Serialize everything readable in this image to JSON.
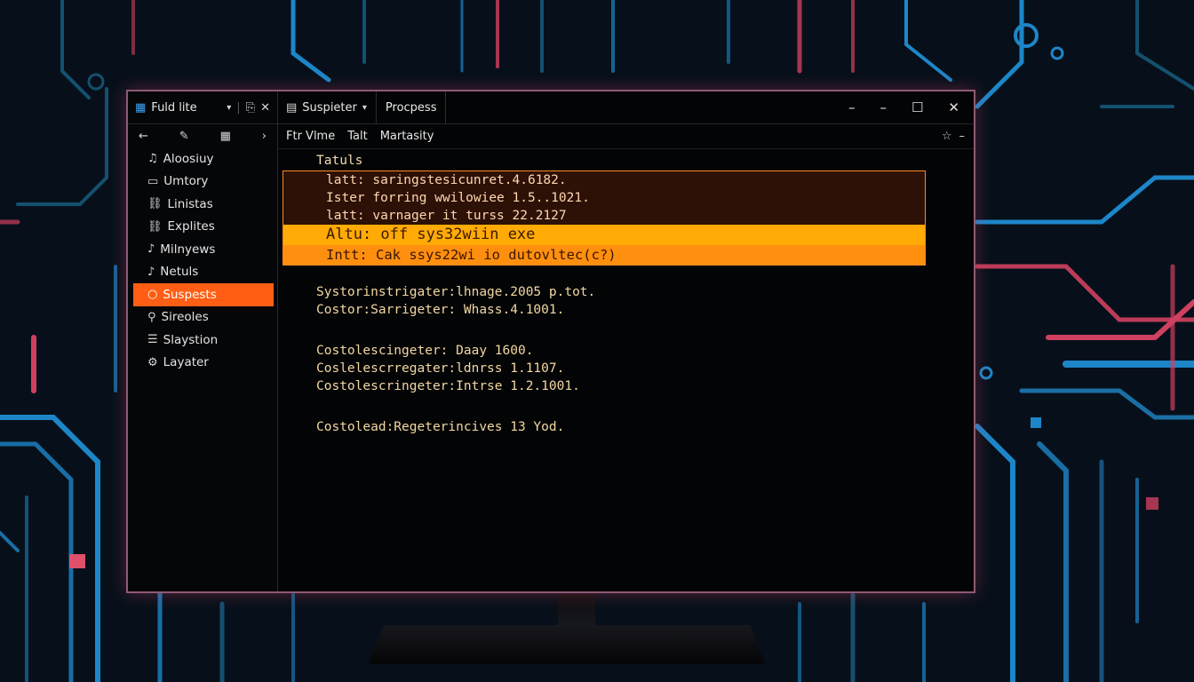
{
  "sidebar": {
    "header_title": "Fuld lite",
    "nav": {
      "back": "←",
      "edit": "✎",
      "grid": "▦",
      "forward": "›"
    },
    "items": [
      {
        "label": "Aloosiuy",
        "icon": "music-note-icon",
        "active": false
      },
      {
        "label": "Umtory",
        "icon": "folder-icon",
        "active": false
      },
      {
        "label": "Linistas",
        "icon": "link-icon",
        "active": false
      },
      {
        "label": "Explites",
        "icon": "link-icon",
        "active": false
      },
      {
        "label": "Milnyews",
        "icon": "music-note-icon",
        "active": false
      },
      {
        "label": "Netuls",
        "icon": "music-note-icon",
        "active": false
      },
      {
        "label": "Suspests",
        "icon": "circle-icon",
        "active": true
      },
      {
        "label": "Sireoles",
        "icon": "search-icon",
        "active": false
      },
      {
        "label": "Slaystion",
        "icon": "list-icon",
        "active": false
      },
      {
        "label": "Layater",
        "icon": "gear-icon",
        "active": false
      }
    ]
  },
  "tabs": [
    {
      "label": "Suspieter",
      "has_dropdown": true
    },
    {
      "label": "Procpess",
      "has_dropdown": false
    }
  ],
  "toolbar": {
    "items": [
      "Ftr Vlme",
      "Talt",
      "Martasity"
    ]
  },
  "content": {
    "status_title": "Tatuls",
    "alert_lines": [
      "latt: saringstesicunret.4.6182.",
      "Ister forring wwilowiee 1.5..1021.",
      "latt: varnager it turss 22.2127"
    ],
    "highlight_lines": [
      "Altu: off sys32wiin exe",
      "Intt: Cak ssys22wi io dutovltec(c?)"
    ],
    "log_group_1": [
      "Systorinstrigater:lhnage.2005 p.tot.",
      "Costor:Sarrigeter: Whass.4.1001."
    ],
    "log_group_2": [
      "Costolescingeter: Daay 1600.",
      "Coslelescrregater:ldnrss 1.1107.",
      "Costolescringeter:Intrse 1.2.1001."
    ],
    "log_group_3": [
      "Costolead:Regeterincives 13 Yod."
    ]
  },
  "colors": {
    "accent_orange": "#ff5e14",
    "highlight_yellow": "#ffaa05",
    "border_pink": "#8d5a76",
    "text_amber": "#f1d9a7"
  }
}
